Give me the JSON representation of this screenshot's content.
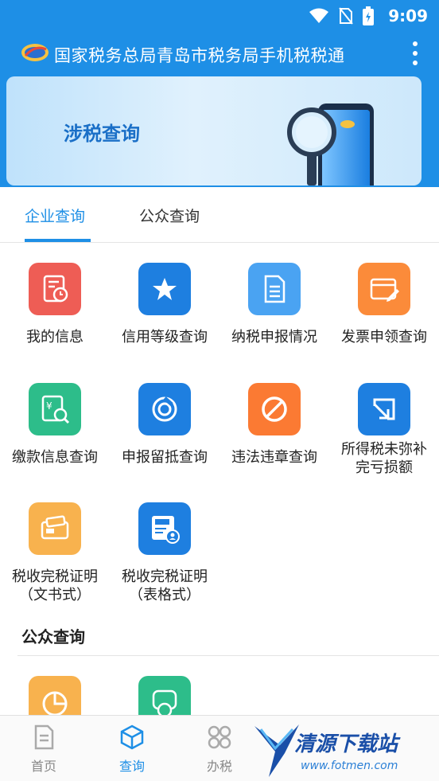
{
  "status_bar": {
    "time": "9:09"
  },
  "app_bar": {
    "title": "国家税务总局青岛市税务局手机税税通"
  },
  "banner": {
    "title": "涉税查询"
  },
  "tabs": [
    {
      "label": "企业查询",
      "active": true
    },
    {
      "label": "公众查询",
      "active": false
    }
  ],
  "enterprise_items": [
    {
      "label": "我的信息",
      "icon": "document-clock-icon",
      "color": "#ee5d55"
    },
    {
      "label": "信用等级查询",
      "icon": "star-icon",
      "color": "#1e7fe0"
    },
    {
      "label": "纳税申报情况",
      "icon": "document-list-icon",
      "color": "#4aa3f2"
    },
    {
      "label": "发票申领查询",
      "icon": "invoice-pen-icon",
      "color": "#fb8b3a"
    },
    {
      "label": "缴款信息查询",
      "icon": "yuan-search-icon",
      "color": "#2dbd8a"
    },
    {
      "label": "申报留抵查询",
      "icon": "cycle-icon",
      "color": "#1e7fe0"
    },
    {
      "label": "违法违章查询",
      "icon": "forbidden-icon",
      "color": "#fb7a33"
    },
    {
      "label1": "所得税未弥补",
      "label2": "完亏损额",
      "icon": "arrow-down-right-icon",
      "color": "#1e7fe0"
    },
    {
      "label1": "税收完税证明",
      "label2": "（文书式）",
      "icon": "wallet-card-icon",
      "color": "#f8b24e"
    },
    {
      "label1": "税收完税证明",
      "label2": "（表格式）",
      "icon": "certificate-user-icon",
      "color": "#1e7fe0"
    }
  ],
  "public_section": {
    "title": "公众查询",
    "items": [
      {
        "icon": "pie-chart-icon",
        "color": "#f8b24e"
      },
      {
        "icon": "tax-car-icon",
        "color": "#2dbd8a"
      }
    ]
  },
  "bottom_nav": [
    {
      "label": "首页",
      "icon": "home-doc-icon",
      "active": false
    },
    {
      "label": "查询",
      "icon": "cube-icon",
      "active": true
    },
    {
      "label": "办税",
      "icon": "grid-icon",
      "active": false
    }
  ],
  "watermark": {
    "text": "清源下载站",
    "url": "www.fotmen.com"
  }
}
